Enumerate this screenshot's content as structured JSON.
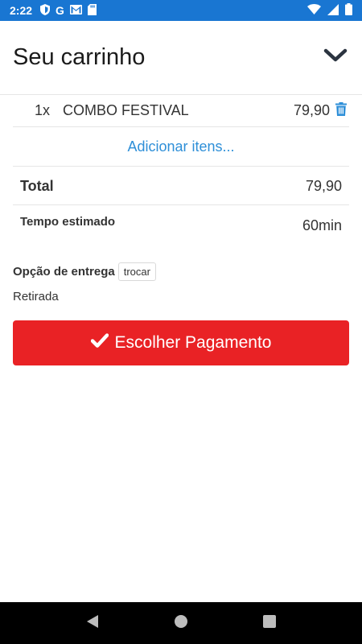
{
  "status_bar": {
    "time": "2:22",
    "left_icons": [
      "shield-icon",
      "google-icon",
      "gmail-icon",
      "sd-card-icon"
    ],
    "google_letter": "G",
    "right_icons": [
      "wifi-icon",
      "signal-icon",
      "battery-icon"
    ]
  },
  "header": {
    "title": "Seu carrinho",
    "collapse_icon": "chevron-down-icon"
  },
  "cart": {
    "items": [
      {
        "qty": "1x",
        "name": "COMBO FESTIVAL",
        "price": "79,90",
        "remove_icon": "trash-icon"
      }
    ],
    "add_items_label": "Adicionar itens...",
    "total_label": "Total",
    "total_value": "79,90",
    "time_label": "Tempo estimado",
    "time_value": "60min"
  },
  "delivery": {
    "label": "Opção de entrega",
    "change_label": "trocar",
    "value": "Retirada"
  },
  "payment_button": {
    "label": "Escolher Pagamento",
    "icon": "check-icon"
  },
  "colors": {
    "status_bar": "#1976d2",
    "accent_red": "#e92225",
    "link_blue": "#2e8fd8"
  },
  "nav_bar": {
    "buttons": [
      "back-icon",
      "home-icon",
      "recents-icon"
    ]
  }
}
